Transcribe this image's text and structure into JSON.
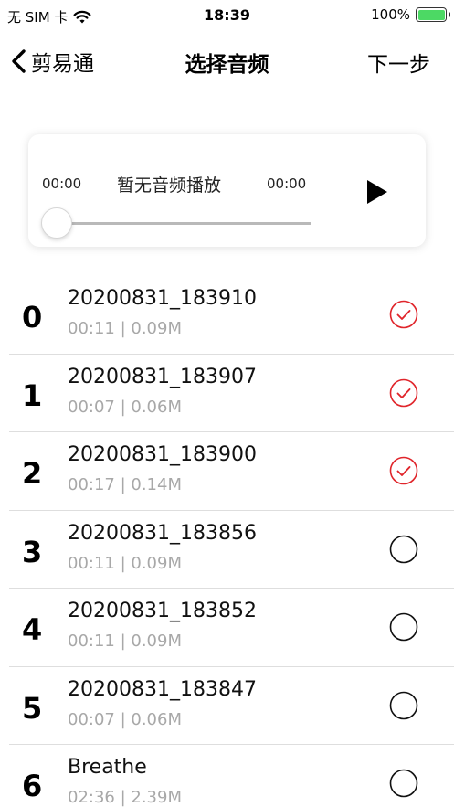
{
  "status_bar": {
    "carrier": "无 SIM 卡",
    "time": "18:39",
    "battery_percent": "100%",
    "battery_level": 1.0
  },
  "nav": {
    "back_label": "剪易通",
    "title": "选择音频",
    "next_label": "下一步"
  },
  "player": {
    "current_time": "00:00",
    "status_text": "暂无音频播放",
    "total_time": "00:00",
    "progress": 0
  },
  "colors": {
    "selected": "#e0252b",
    "unselected": "#111111",
    "battery": "#4cd964"
  },
  "audio_list": [
    {
      "index": "0",
      "name": "20200831_183910",
      "meta": "00:11 | 0.09M",
      "selected": true
    },
    {
      "index": "1",
      "name": "20200831_183907",
      "meta": "00:07 | 0.06M",
      "selected": true
    },
    {
      "index": "2",
      "name": "20200831_183900",
      "meta": "00:17 | 0.14M",
      "selected": true
    },
    {
      "index": "3",
      "name": "20200831_183856",
      "meta": "00:11 | 0.09M",
      "selected": false
    },
    {
      "index": "4",
      "name": "20200831_183852",
      "meta": "00:11 | 0.09M",
      "selected": false
    },
    {
      "index": "5",
      "name": "20200831_183847",
      "meta": "00:07 | 0.06M",
      "selected": false
    },
    {
      "index": "6",
      "name": "Breathe",
      "meta": "02:36 | 2.39M",
      "selected": false
    }
  ]
}
